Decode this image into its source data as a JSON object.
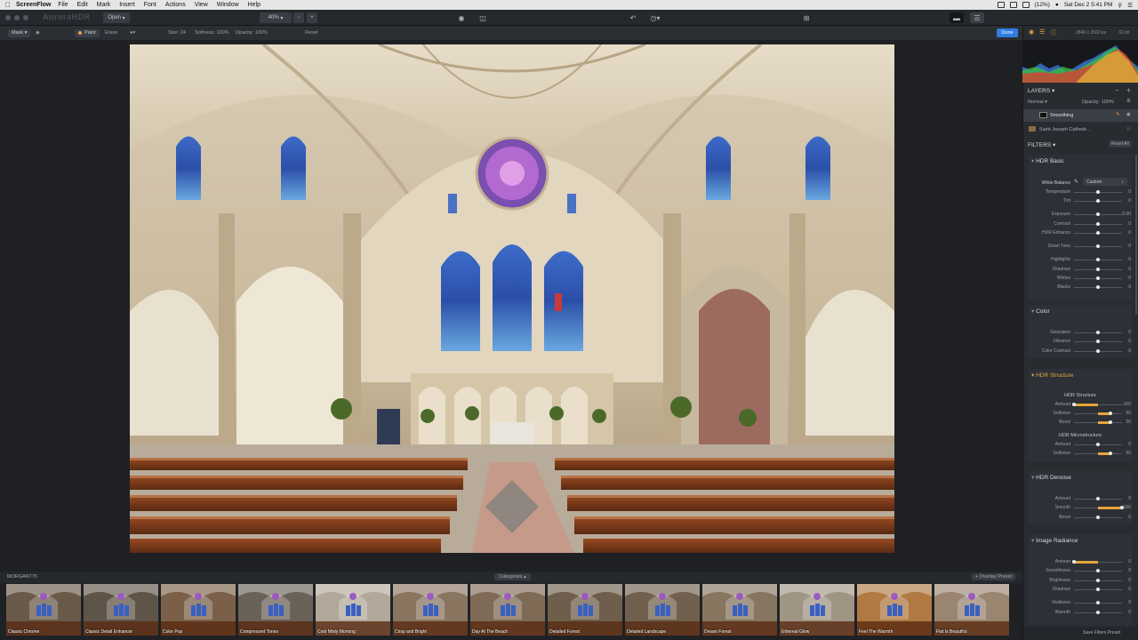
{
  "menubar": {
    "app": "ScreenFlow",
    "items": [
      "File",
      "Edit",
      "Mark",
      "Insert",
      "Font",
      "Actions",
      "View",
      "Window",
      "Help"
    ],
    "battery": "(12%)",
    "datetime": "Sat Dec 2  5:41 PM"
  },
  "toolbar": {
    "window_title": "AuroraHDR",
    "open_label": "Open",
    "zoom": "40%"
  },
  "options": {
    "mask": "Mask",
    "paint": "Paint",
    "erase": "Erase",
    "size": "Size: 24",
    "softness": "Softness: 100%",
    "opacity": "Opacity: 100%",
    "reset": "Reset",
    "done": "Done"
  },
  "info": {
    "dimensions": "3846 x 2560 px",
    "bitdepth": "32-bit"
  },
  "layers": {
    "title": "LAYERS",
    "blend": "Normal",
    "opacity": "Opacity: 100%",
    "items": [
      "Smoothing",
      "Saint Joseph Cathedr..."
    ]
  },
  "filters": {
    "title": "FILTERS",
    "reset_all": "Reset All",
    "hdr_basic": {
      "title": "HDR Basic",
      "white_balance_label": "White Balance",
      "white_balance_value": "Custom",
      "rows": [
        {
          "name": "Temperature",
          "value": "0",
          "pos": 0.5
        },
        {
          "name": "Tint",
          "value": "0",
          "pos": 0.5
        },
        {
          "name": "Exposure",
          "value": "0.00",
          "pos": 0.5
        },
        {
          "name": "Contrast",
          "value": "0",
          "pos": 0.5
        },
        {
          "name": "HDR Enhance",
          "value": "0",
          "pos": 0.5
        },
        {
          "name": "Smart Tone",
          "value": "0",
          "pos": 0.5
        },
        {
          "name": "Highlights",
          "value": "0",
          "pos": 0.5
        },
        {
          "name": "Shadows",
          "value": "0",
          "pos": 0.5
        },
        {
          "name": "Whites",
          "value": "0",
          "pos": 0.5
        },
        {
          "name": "Blacks",
          "value": "0",
          "pos": 0.5
        }
      ]
    },
    "color": {
      "title": "Color",
      "rows": [
        {
          "name": "Saturation",
          "value": "0",
          "pos": 0.5
        },
        {
          "name": "Vibrance",
          "value": "0",
          "pos": 0.5
        },
        {
          "name": "Color Contrast",
          "value": "0",
          "pos": 0.5
        }
      ]
    },
    "hdr_structure": {
      "title": "HDR Structure",
      "sub1": "HDR Structure",
      "rows1": [
        {
          "name": "Amount",
          "value": "-100",
          "pos": 0.0
        },
        {
          "name": "Softness",
          "value": "50",
          "pos": 0.75
        },
        {
          "name": "Boost",
          "value": "50",
          "pos": 0.75
        }
      ],
      "sub2": "HDR Microstructure",
      "rows2": [
        {
          "name": "Amount",
          "value": "0",
          "pos": 0.5
        },
        {
          "name": "Softness",
          "value": "50",
          "pos": 0.75
        }
      ]
    },
    "hdr_denoise": {
      "title": "HDR Denoise",
      "rows": [
        {
          "name": "Amount",
          "value": "0",
          "pos": 0.5
        },
        {
          "name": "Smooth",
          "value": "100",
          "pos": 1.0
        },
        {
          "name": "Boost",
          "value": "0",
          "pos": 0.5
        }
      ]
    },
    "image_radiance": {
      "title": "Image Radiance",
      "rows": [
        {
          "name": "Amount",
          "value": "0",
          "pos": 0.0
        },
        {
          "name": "Smoothness",
          "value": "0",
          "pos": 0.5
        },
        {
          "name": "Brightness",
          "value": "0",
          "pos": 0.5
        },
        {
          "name": "Shadows",
          "value": "0",
          "pos": 0.5
        },
        {
          "name": "Vividness",
          "value": "0",
          "pos": 0.5
        },
        {
          "name": "Warmth",
          "value": "0",
          "pos": 0.5
        }
      ]
    },
    "save_preset": "Save Filters Preset"
  },
  "filmstrip": {
    "collection": "MORGAN775",
    "categories": "Categories",
    "overlay": "+ Overlay Preset",
    "presets": [
      "Classic Chrome",
      "Classic Detail Enhancer",
      "Color Pop",
      "Compressed Tones",
      "Cool Misty Morning",
      "Crisp and Bright",
      "Day At The Beach",
      "Detailed Forest",
      "Detailed Landscape",
      "Dream Forest",
      "Ethereal Glow",
      "Feel The Warmth",
      "Flat Is Beautiful"
    ],
    "tints": [
      "#6a5a4a",
      "#5f5448",
      "#7a6048",
      "#6a6258",
      "#b2a89a",
      "#8a7560",
      "#7e6a55",
      "#6f5e4c",
      "#71604e",
      "#86755f",
      "#a09585",
      "#b07a42",
      "#9a8570"
    ]
  }
}
